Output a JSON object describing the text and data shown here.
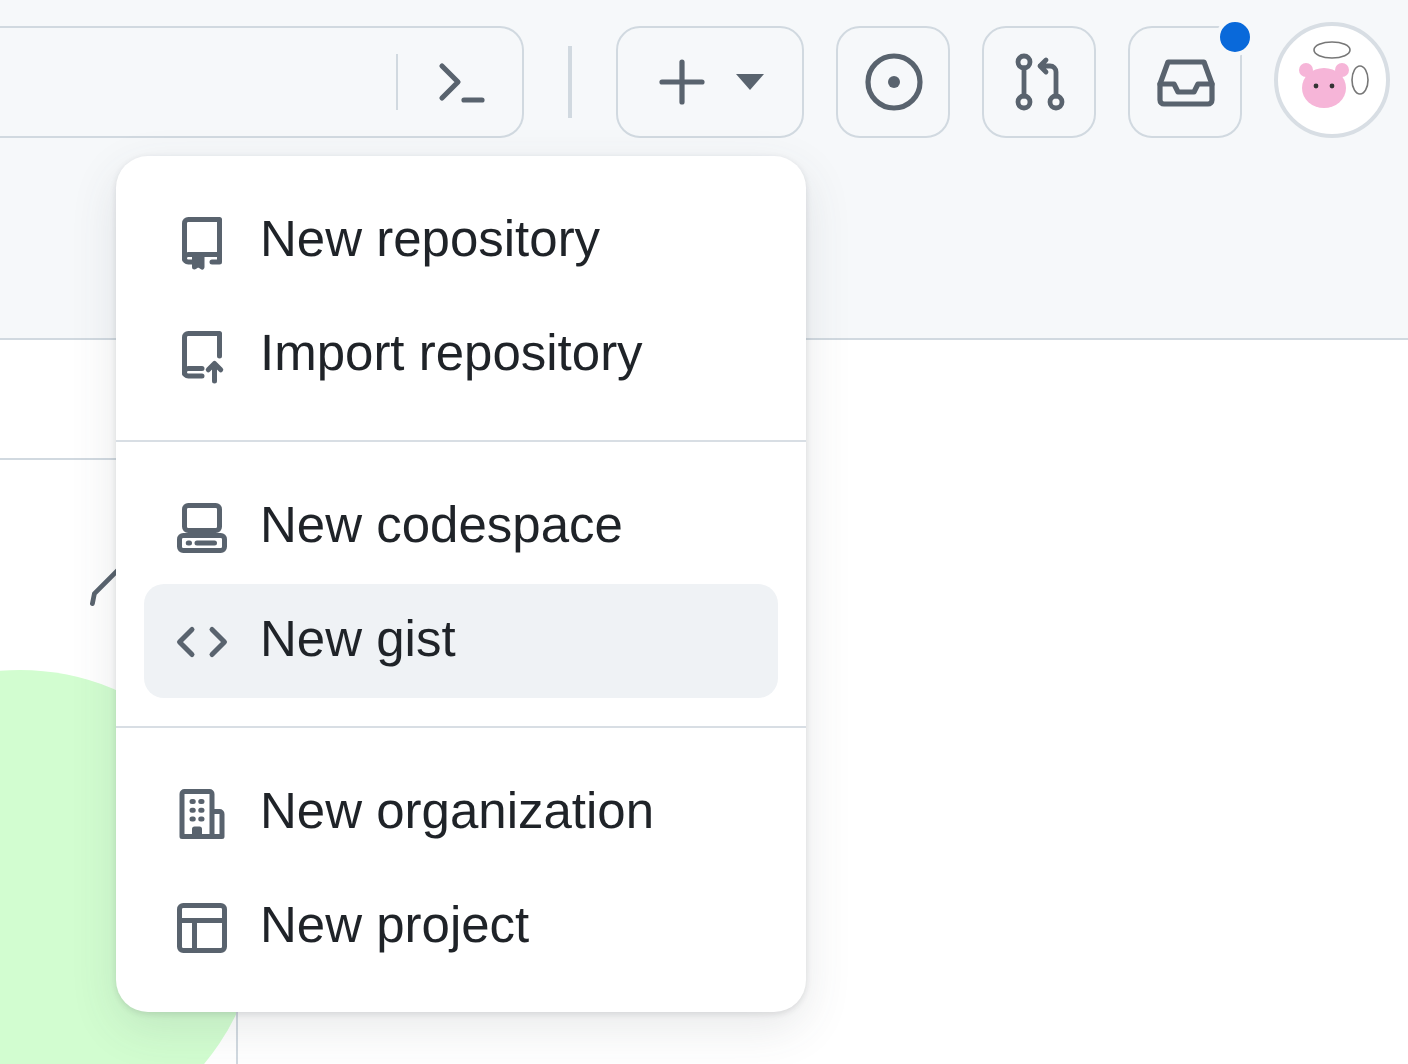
{
  "header": {
    "has_notification": true
  },
  "menu": {
    "groups": [
      [
        {
          "kind": "repo",
          "label": "New repository",
          "selected": false
        },
        {
          "kind": "import",
          "label": "Import repository",
          "selected": false
        }
      ],
      [
        {
          "kind": "codespace",
          "label": "New codespace",
          "selected": false
        },
        {
          "kind": "gist",
          "label": "New gist",
          "selected": true
        }
      ],
      [
        {
          "kind": "org",
          "label": "New organization",
          "selected": false
        },
        {
          "kind": "project",
          "label": "New project",
          "selected": false
        }
      ]
    ]
  }
}
